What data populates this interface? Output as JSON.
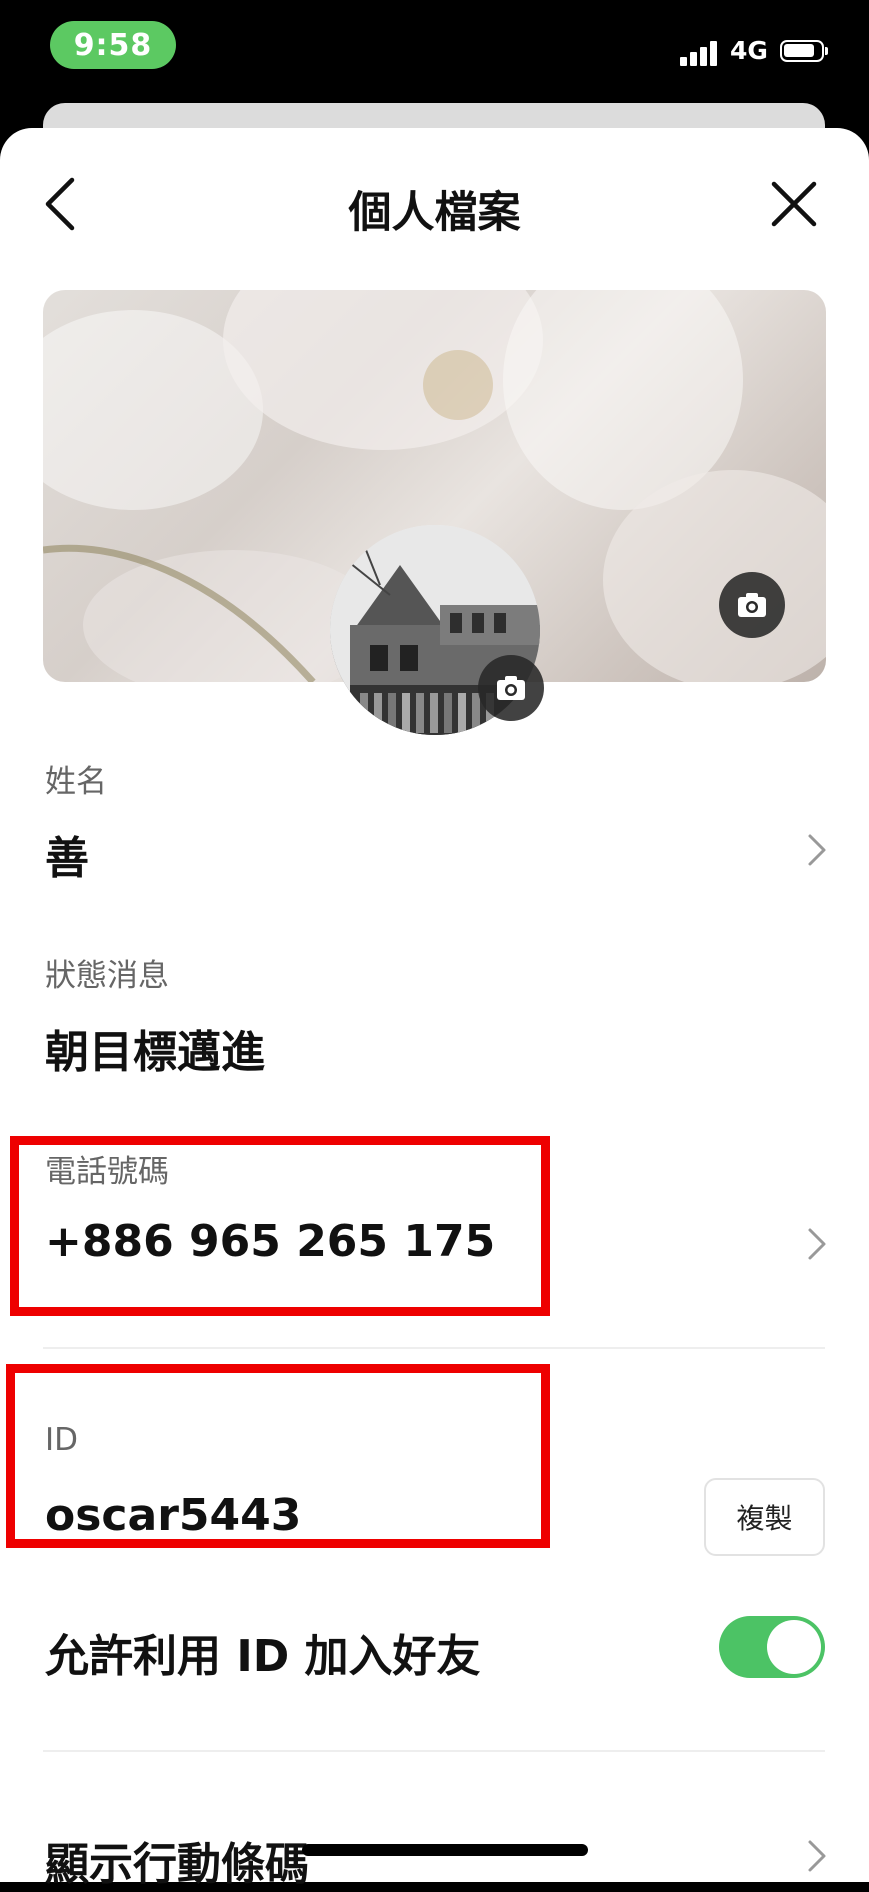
{
  "status_bar": {
    "time": "9:58",
    "network": "4G",
    "time_pill_color": "#5cc962"
  },
  "header": {
    "title": "個人檔案",
    "back_icon": "chevron-left-icon",
    "close_icon": "close-icon"
  },
  "profile": {
    "cover_camera_icon": "camera-icon",
    "avatar_camera_icon": "camera-icon"
  },
  "fields": {
    "name": {
      "label": "姓名",
      "value": "善"
    },
    "status_message": {
      "label": "狀態消息",
      "value": "朝目標邁進"
    },
    "phone": {
      "label": "電話號碼",
      "value": "+886 965 265 175"
    },
    "id": {
      "label": "ID",
      "value": "oscar5443",
      "copy_label": "複製"
    }
  },
  "settings": {
    "allow_add_by_id": {
      "label": "允許利用 ID 加入好友",
      "enabled": true,
      "toggle_color": "#4cc365"
    },
    "show_qr": {
      "label": "顯示行動條碼"
    }
  },
  "annotation_color": "#ee0000"
}
